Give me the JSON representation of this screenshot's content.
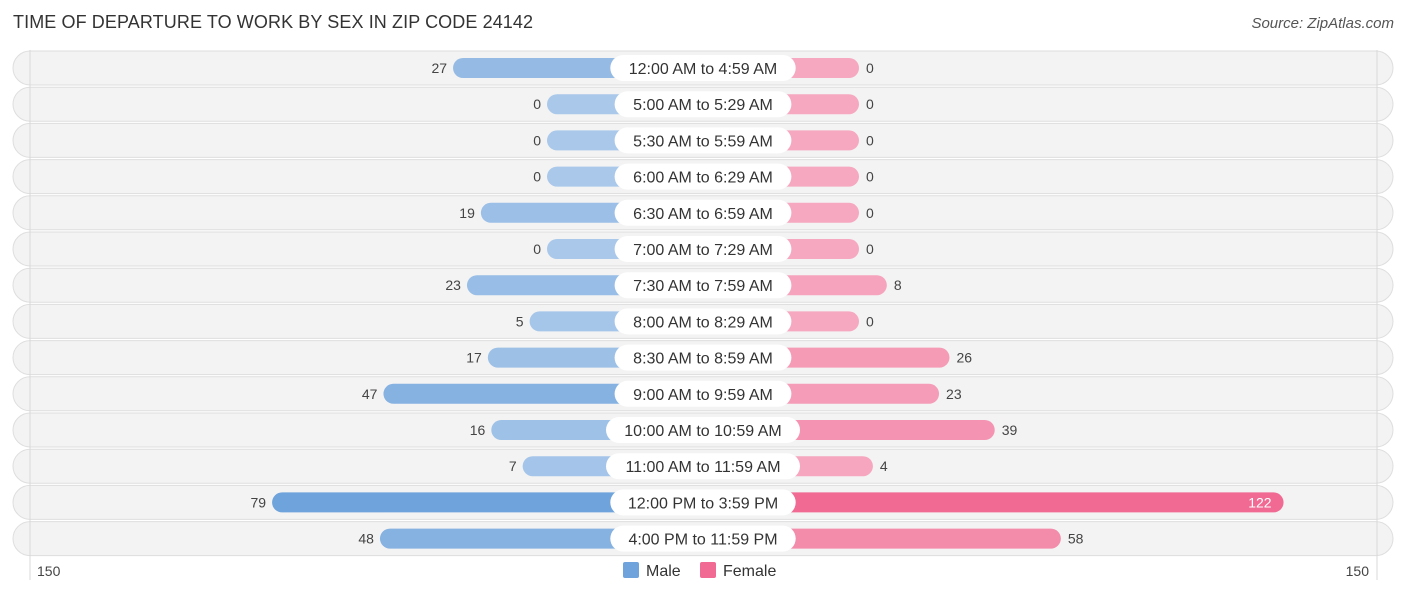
{
  "header": {
    "title": "TIME OF DEPARTURE TO WORK BY SEX IN ZIP CODE 24142",
    "source": "Source: ZipAtlas.com"
  },
  "colors": {
    "male": "#6fa3dc",
    "male_light": "#a9c8ea",
    "female": "#f06a93",
    "female_light": "#f6a8c0"
  },
  "chart_data": {
    "type": "bar",
    "orientation": "horizontal-diverging",
    "title": "TIME OF DEPARTURE TO WORK BY SEX IN ZIP CODE 24142",
    "categories": [
      "12:00 AM to 4:59 AM",
      "5:00 AM to 5:29 AM",
      "5:30 AM to 5:59 AM",
      "6:00 AM to 6:29 AM",
      "6:30 AM to 6:59 AM",
      "7:00 AM to 7:29 AM",
      "7:30 AM to 7:59 AM",
      "8:00 AM to 8:29 AM",
      "8:30 AM to 8:59 AM",
      "9:00 AM to 9:59 AM",
      "10:00 AM to 10:59 AM",
      "11:00 AM to 11:59 AM",
      "12:00 PM to 3:59 PM",
      "4:00 PM to 11:59 PM"
    ],
    "series": [
      {
        "name": "Male",
        "values": [
          27,
          0,
          0,
          0,
          19,
          0,
          23,
          5,
          17,
          47,
          16,
          7,
          79,
          48
        ]
      },
      {
        "name": "Female",
        "values": [
          0,
          0,
          0,
          0,
          0,
          0,
          8,
          0,
          26,
          23,
          39,
          4,
          122,
          58
        ]
      }
    ],
    "axis": {
      "left_label": "150",
      "right_label": "150",
      "max": 150
    },
    "legend": {
      "position": "bottom-center",
      "items": [
        "Male",
        "Female"
      ]
    },
    "xlabel": "",
    "ylabel": ""
  }
}
